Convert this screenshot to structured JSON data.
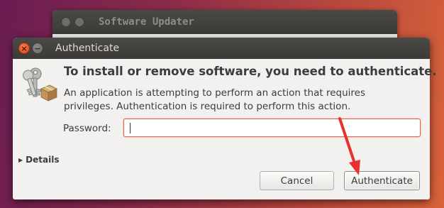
{
  "background_window": {
    "title": "Software Updater"
  },
  "dialog": {
    "title": "Authenticate",
    "heading": "To install or remove software, you need to authenticate.",
    "description": "An application is attempting to perform an action that requires privileges. Authentication is required to perform this action.",
    "password_label": "Password:",
    "password_value": "",
    "details_label": "Details",
    "cancel_label": "Cancel",
    "authenticate_label": "Authenticate",
    "icons": {
      "window": "keys-icon",
      "close": "close-icon",
      "minimize": "minimize-icon",
      "details": "triangle-right-icon"
    }
  },
  "colors": {
    "annotation_arrow": "#e8322f",
    "input_focus_border": "#e06a4a",
    "titlebar": "#3c3b37",
    "close_button": "#de4815"
  }
}
